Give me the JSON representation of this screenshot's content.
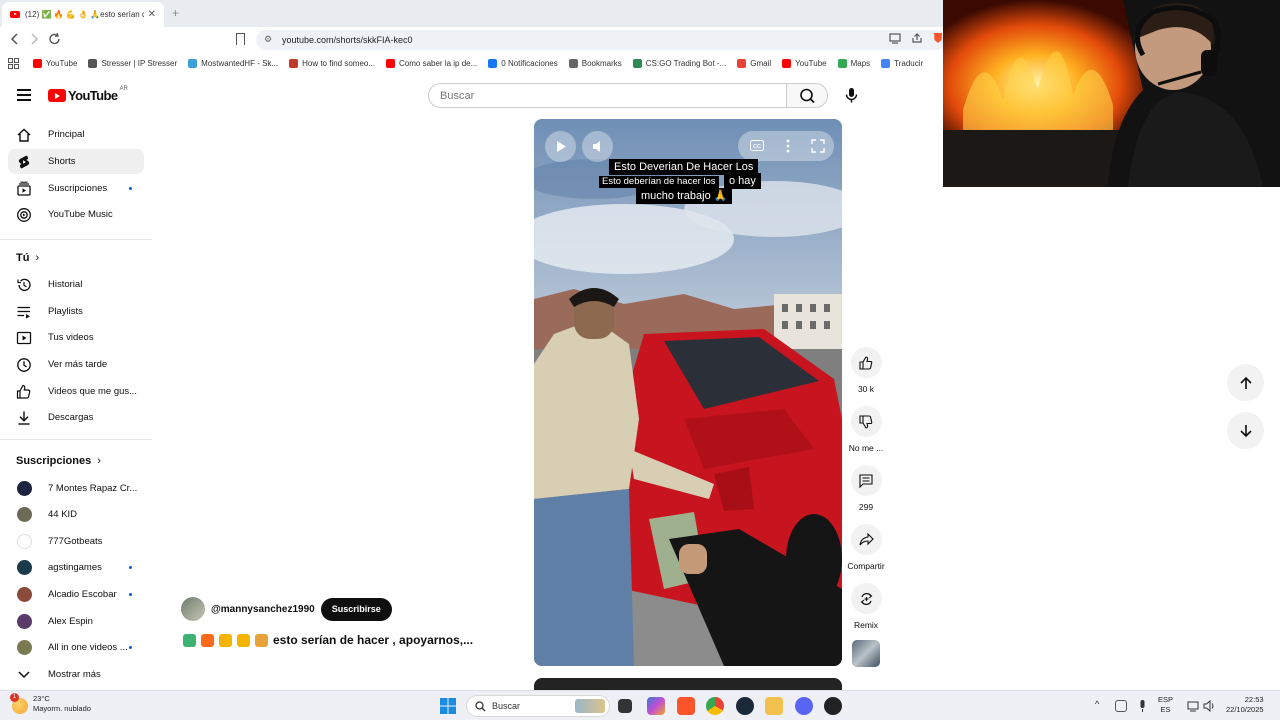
{
  "browser": {
    "tab_title": "(12) ✅ 🔥 💪 👌 🙏esto serían d",
    "tab_close": "✕",
    "new_tab": "+",
    "url": "youtube.com/shorts/skkFIA-kec0",
    "bookmarks": [
      {
        "label": "YouTube",
        "color": "#ff0000"
      },
      {
        "label": "Stresser | IP Stresser",
        "color": "#555555"
      },
      {
        "label": "MostwantedHF - Sk...",
        "color": "#3aa0d8"
      },
      {
        "label": "How to find someo...",
        "color": "#c0392b"
      },
      {
        "label": "Como saber la ip de...",
        "color": "#ff0000"
      },
      {
        "label": "0 Notificaciones",
        "color": "#1877f2"
      },
      {
        "label": "Bookmarks",
        "color": "#666666"
      },
      {
        "label": "CS:GO Trading Bot -...",
        "color": "#2e8b57"
      },
      {
        "label": "Gmail",
        "color": "#ea4335"
      },
      {
        "label": "YouTube",
        "color": "#ff0000"
      },
      {
        "label": "Maps",
        "color": "#34a853"
      },
      {
        "label": "Traducir",
        "color": "#4285f4"
      }
    ]
  },
  "header": {
    "logo_text": "YouTube",
    "country_code": "AR",
    "search_placeholder": "Buscar"
  },
  "sidebar": {
    "main": [
      {
        "label": "Principal",
        "icon": "home-icon",
        "active": false
      },
      {
        "label": "Shorts",
        "icon": "shorts-icon",
        "active": true
      },
      {
        "label": "Suscripciones",
        "icon": "subscriptions-icon",
        "active": false,
        "dot": true
      },
      {
        "label": "YouTube Music",
        "icon": "music-icon",
        "active": false
      }
    ],
    "you_heading": "Tú",
    "you_items": [
      {
        "label": "Historial",
        "icon": "history-icon"
      },
      {
        "label": "Playlists",
        "icon": "playlists-icon"
      },
      {
        "label": "Tus videos",
        "icon": "your-videos-icon"
      },
      {
        "label": "Ver más tarde",
        "icon": "watch-later-icon"
      },
      {
        "label": "Videos que me gus...",
        "icon": "liked-icon"
      },
      {
        "label": "Descargas",
        "icon": "downloads-icon"
      }
    ],
    "subs_heading": "Suscripciones",
    "subs": [
      {
        "label": "7 Montes Rapaz Cr...",
        "color": "#1d2440",
        "dot": false
      },
      {
        "label": "44 KID",
        "color": "#6d6a58",
        "dot": false
      },
      {
        "label": "777Gotbeats",
        "color": "#ffffff",
        "dot": false
      },
      {
        "label": "agstingames",
        "color": "#1b3a4b",
        "dot": true
      },
      {
        "label": "Alcadio Escobar",
        "color": "#8a4b3a",
        "dot": true
      },
      {
        "label": "Alex Espin",
        "color": "#5a3c6a",
        "dot": false
      },
      {
        "label": "All in one videos ...",
        "color": "#7a7a52",
        "dot": true
      }
    ],
    "show_more": "Mostrar más"
  },
  "video": {
    "caption_line1": "Esto Deverian De Hacer Los",
    "caption_overlay": "Esto deberían de hacer los",
    "caption_line2_tail": "o hay",
    "caption_line3": "mucho trabajo 🙏",
    "channel": "@mannysanchez1990",
    "subscribe": "Suscribirse",
    "title": "esto serían de hacer , apoyarnos,...",
    "title_emoji_colors": [
      "#3cb371",
      "#ff6a1a",
      "#f5b400",
      "#f5b400",
      "#e8a23a"
    ]
  },
  "actions": [
    {
      "name": "like",
      "label": "30 k"
    },
    {
      "name": "dislike",
      "label": "No me ..."
    },
    {
      "name": "comments",
      "label": "299"
    },
    {
      "name": "share",
      "label": "Compartir"
    },
    {
      "name": "remix",
      "label": "Remix"
    }
  ],
  "taskbar": {
    "weather_temp": "23°C",
    "weather_desc": "Mayorm. nublado",
    "weather_badge": "1",
    "search_placeholder": "Buscar",
    "lang_top": "ESP",
    "lang_bottom": "ES",
    "time": "22:53",
    "date": "22/10/2025"
  },
  "colors": {
    "accent": "#ff0000",
    "subscribe_bg": "#0f0f0f",
    "link_dot": "#065fd4"
  }
}
